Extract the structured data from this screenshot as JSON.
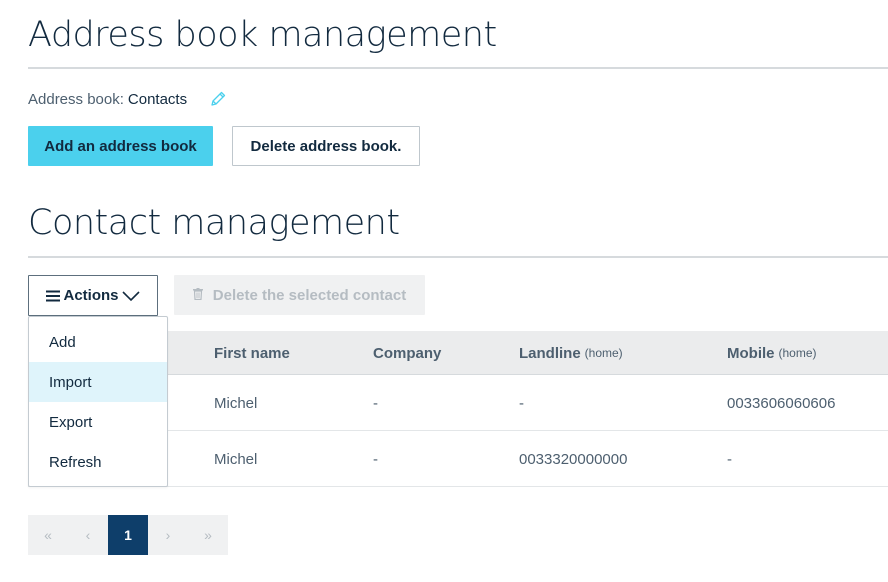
{
  "address_book_section": {
    "title": "Address book management",
    "label": "Address book:",
    "value": "Contacts",
    "add_button": "Add an address book",
    "delete_button": "Delete address book."
  },
  "contact_section": {
    "title": "Contact management",
    "actions_button": "Actions",
    "delete_selected_button": "Delete the selected contact",
    "actions_menu": {
      "items": [
        {
          "label": "Add"
        },
        {
          "label": "Import"
        },
        {
          "label": "Export"
        },
        {
          "label": "Refresh"
        }
      ],
      "highlighted": "Import"
    },
    "table": {
      "columns": [
        {
          "label": "First name",
          "sub": ""
        },
        {
          "label": "Company",
          "sub": ""
        },
        {
          "label": "Landline",
          "sub": "(home)"
        },
        {
          "label": "Mobile",
          "sub": "(home)"
        }
      ],
      "rows": [
        {
          "first_name": "Michel",
          "company": "-",
          "landline": "-",
          "mobile": "0033606060606"
        },
        {
          "first_name": "Michel",
          "company": "-",
          "landline": "0033320000000",
          "mobile": "-"
        }
      ]
    },
    "pagination": {
      "first": "«",
      "prev": "‹",
      "current_page": "1",
      "next": "›",
      "last": "»"
    }
  },
  "colors": {
    "primary": "#4bd0ed",
    "text_dark": "#122a3f",
    "pagination_active": "#0e3e6a",
    "menu_highlight": "#dff4fb"
  },
  "icons": {
    "edit": "pencil-icon",
    "menu": "hamburger-icon",
    "chevron": "chevron-down-icon",
    "trash": "trash-icon"
  }
}
